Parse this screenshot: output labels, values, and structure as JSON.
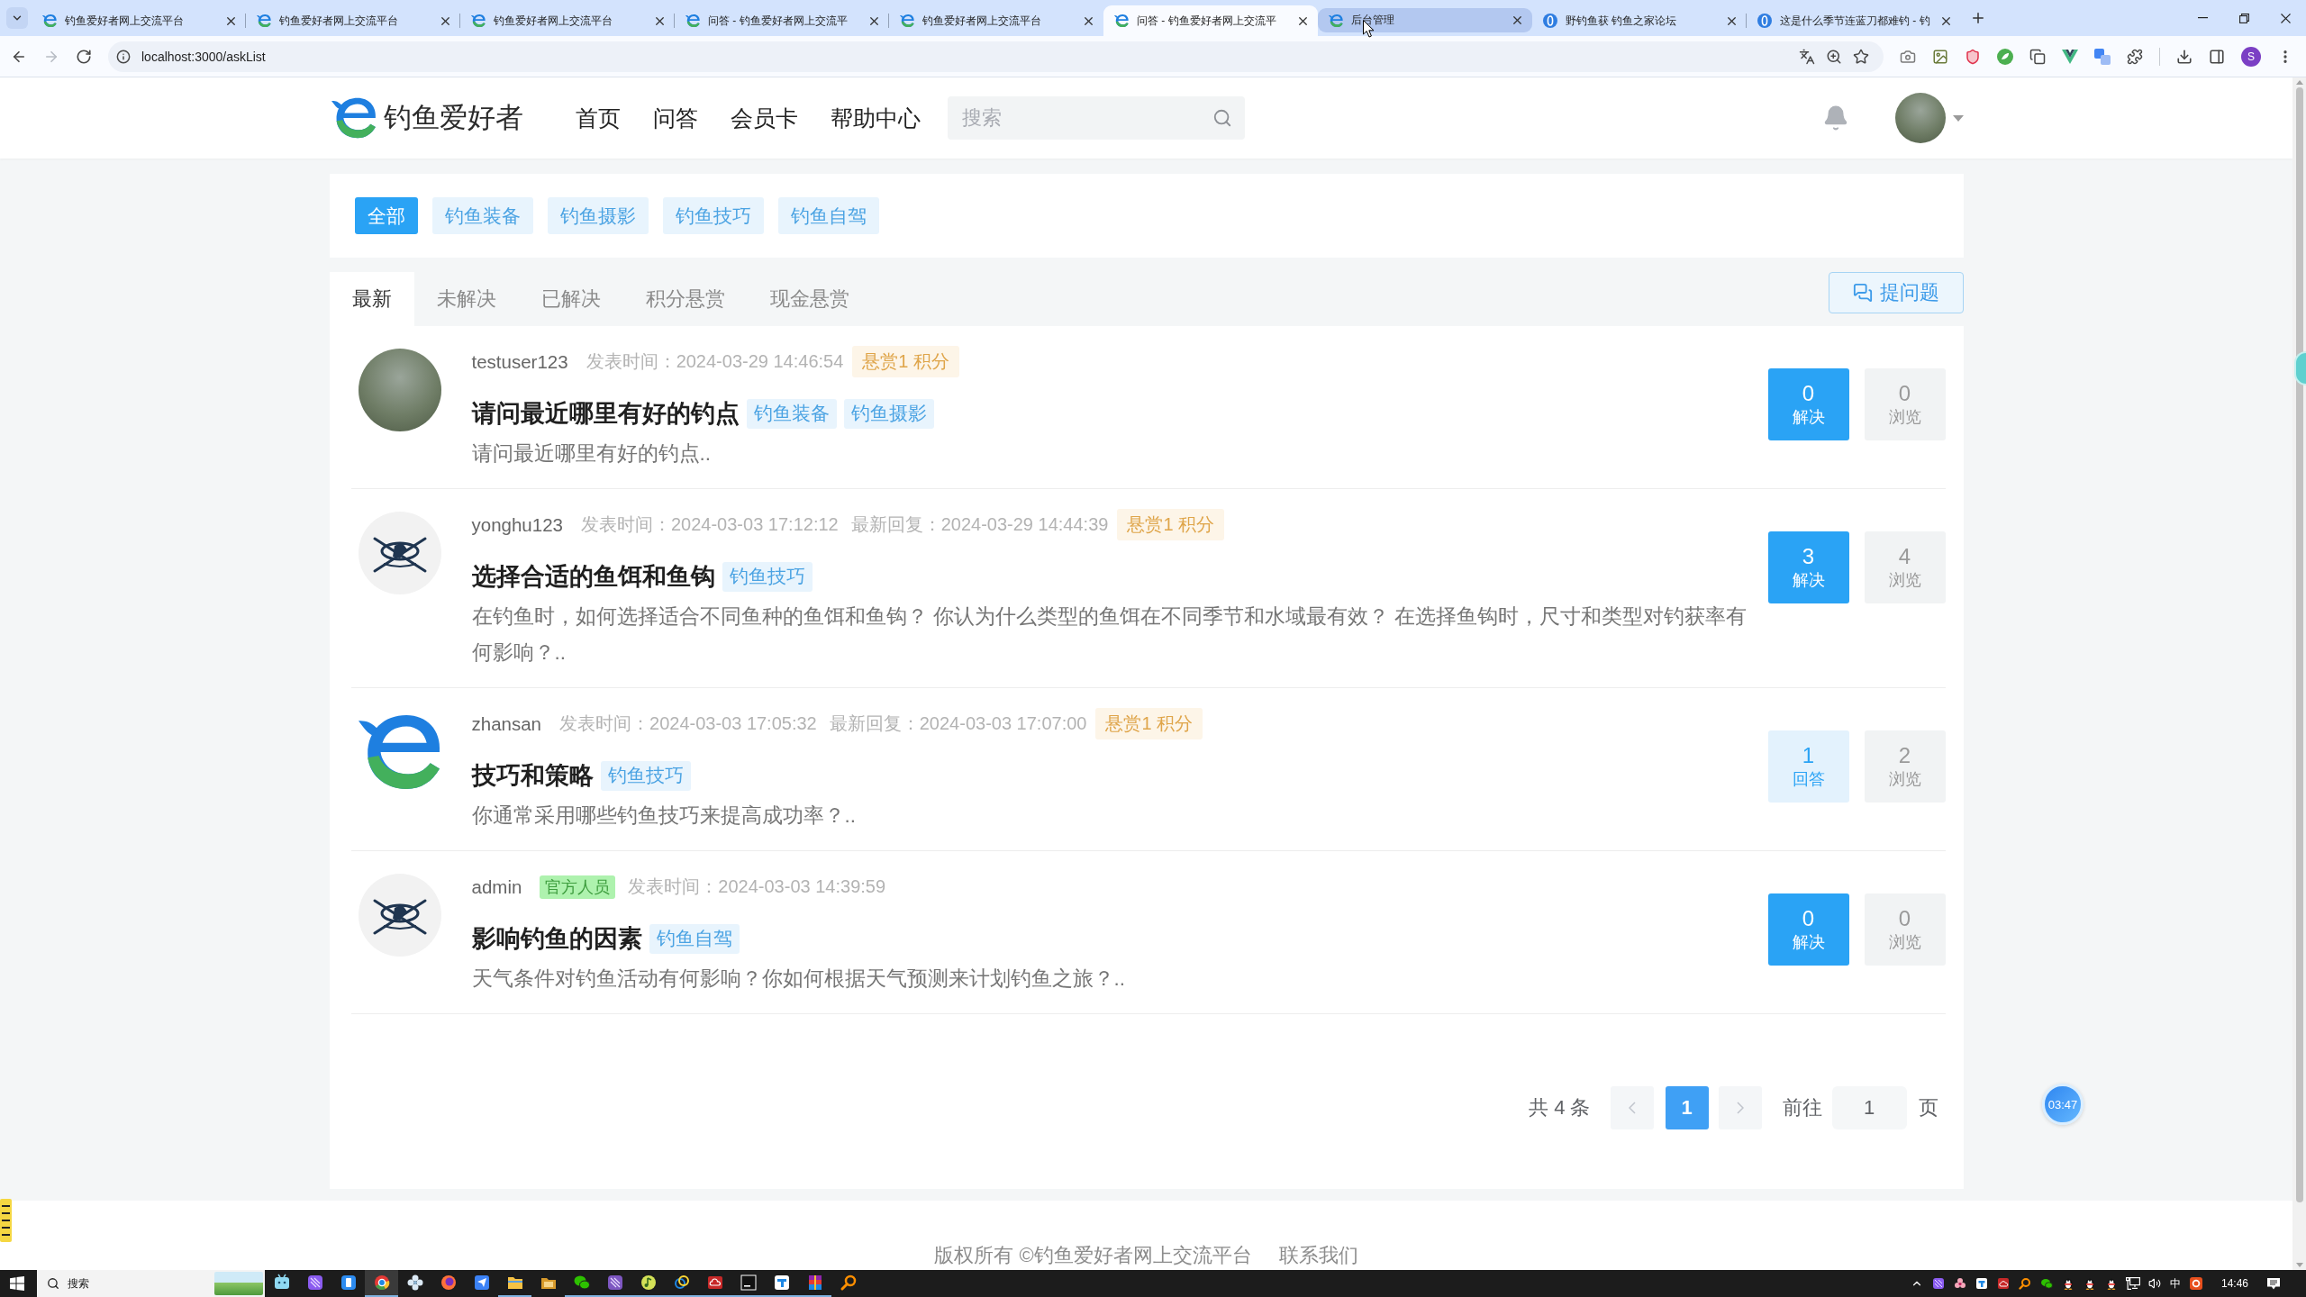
{
  "browser": {
    "tabs": [
      {
        "title": "钓鱼爱好者网上交流平台",
        "kind": "site",
        "selected": false,
        "hovered": false
      },
      {
        "title": "钓鱼爱好者网上交流平台",
        "kind": "site",
        "selected": false,
        "hovered": false
      },
      {
        "title": "钓鱼爱好者网上交流平台",
        "kind": "site",
        "selected": false,
        "hovered": false
      },
      {
        "title": "问答 - 钓鱼爱好者网上交流平",
        "kind": "site",
        "selected": false,
        "hovered": false
      },
      {
        "title": "钓鱼爱好者网上交流平台",
        "kind": "site",
        "selected": false,
        "hovered": false
      },
      {
        "title": "问答 - 钓鱼爱好者网上交流平",
        "kind": "site",
        "selected": true,
        "hovered": false
      },
      {
        "title": "后台管理",
        "kind": "site",
        "selected": false,
        "hovered": true
      },
      {
        "title": "野钓鱼获 钓鱼之家论坛",
        "kind": "forum",
        "selected": false,
        "hovered": false
      },
      {
        "title": "这是什么季节连蓝刀都难钓 - 钓",
        "kind": "forum",
        "selected": false,
        "hovered": false
      }
    ],
    "forward": {
      "disabled": true
    },
    "address": "localhost:3000/askList",
    "profile": "S"
  },
  "header": {
    "logo": "钓鱼爱好者",
    "nav": [
      {
        "label": "首页",
        "selected": false
      },
      {
        "label": "问答",
        "selected": false
      },
      {
        "label": "会员卡",
        "selected": false
      },
      {
        "label": "帮助中心",
        "selected": false
      }
    ],
    "search": {
      "placeholder": "搜索"
    }
  },
  "categories": [
    {
      "label": "全部",
      "selected": true
    },
    {
      "label": "钓鱼装备",
      "selected": false
    },
    {
      "label": "钓鱼摄影",
      "selected": false
    },
    {
      "label": "钓鱼技巧",
      "selected": false
    },
    {
      "label": "钓鱼自驾",
      "selected": false
    }
  ],
  "tabs": [
    {
      "label": "最新",
      "selected": true
    },
    {
      "label": "未解决",
      "selected": false
    },
    {
      "label": "已解决",
      "selected": false
    },
    {
      "label": "积分悬赏",
      "selected": false
    },
    {
      "label": "现金悬赏",
      "selected": false
    }
  ],
  "ask_button": "提问题",
  "questions": [
    {
      "avatar": {
        "kind": "photo"
      },
      "user": "testuser123",
      "posted": "发表时间：2024-03-29 14:46:54",
      "reward": "悬赏1 积分",
      "title": "请问最近哪里有好的钓点",
      "tags": [
        "钓鱼装备",
        "钓鱼摄影"
      ],
      "excerpt": "请问最近哪里有好的钓点..",
      "answers": {
        "count": "0",
        "label": "解决",
        "solved": true
      },
      "views": {
        "count": "0",
        "label": "浏览"
      }
    },
    {
      "avatar": {
        "kind": "emblem"
      },
      "user": "yonghu123",
      "posted": "发表时间：2024-03-03 17:12:12",
      "last_reply": "最新回复：2024-03-29 14:44:39",
      "reward": "悬赏1 积分",
      "title": "选择合适的鱼饵和鱼钩",
      "tags": [
        "钓鱼技巧"
      ],
      "excerpt": "在钓鱼时，如何选择适合不同鱼种的鱼饵和鱼钩？ 你认为什么类型的鱼饵在不同季节和水域最有效？ 在选择鱼钩时，尺寸和类型对钓获率有何影响？..",
      "answers": {
        "count": "3",
        "label": "解决",
        "solved": true
      },
      "views": {
        "count": "4",
        "label": "浏览"
      }
    },
    {
      "avatar": {
        "kind": "logo"
      },
      "user": "zhansan",
      "posted": "发表时间：2024-03-03 17:05:32",
      "last_reply": "最新回复：2024-03-03 17:07:00",
      "reward": "悬赏1 积分",
      "title": "技巧和策略",
      "tags": [
        "钓鱼技巧"
      ],
      "excerpt": "你通常采用哪些钓鱼技巧来提高成功率？..",
      "answers": {
        "count": "1",
        "label": "回答",
        "solved": false
      },
      "views": {
        "count": "2",
        "label": "浏览"
      }
    },
    {
      "avatar": {
        "kind": "emblem"
      },
      "user": "admin",
      "role": "官方人员",
      "posted": "发表时间：2024-03-03 14:39:59",
      "title": "影响钓鱼的因素",
      "tags": [
        "钓鱼自驾"
      ],
      "excerpt": "天气条件对钓鱼活动有何影响？你如何根据天气预测来计划钓鱼之旅？..",
      "answers": {
        "count": "0",
        "label": "解决",
        "solved": true
      },
      "views": {
        "count": "0",
        "label": "浏览"
      }
    }
  ],
  "pagination": {
    "total": "共 4 条",
    "prev": {
      "disabled": true
    },
    "pages": [
      {
        "label": "1",
        "selected": true
      }
    ],
    "next": {
      "disabled": true
    },
    "goto": "前往",
    "goto_value": "1",
    "suffix": "页"
  },
  "timer": "03:47",
  "footer": {
    "copyright": "版权所有 ©钓鱼爱好者网上交流平台",
    "contact": "联系我们"
  },
  "taskbar": {
    "search": {
      "placeholder": "搜索"
    },
    "apps": [
      {
        "running": false,
        "selected": false
      },
      {
        "running": false,
        "selected": false
      },
      {
        "running": false,
        "selected": false
      },
      {
        "running": true,
        "selected": true
      },
      {
        "running": false,
        "selected": false
      },
      {
        "running": false,
        "selected": false
      },
      {
        "running": false,
        "selected": false
      },
      {
        "running": true,
        "selected": false
      },
      {
        "running": false,
        "selected": false
      },
      {
        "running": true,
        "selected": false
      },
      {
        "running": true,
        "selected": false
      },
      {
        "running": true,
        "selected": false
      },
      {
        "running": true,
        "selected": false
      },
      {
        "running": true,
        "selected": false
      },
      {
        "running": true,
        "selected": false
      },
      {
        "running": true,
        "selected": false
      },
      {
        "running": true,
        "selected": false
      },
      {
        "running": false,
        "selected": false
      }
    ],
    "ime": "中",
    "time": "14:46"
  }
}
